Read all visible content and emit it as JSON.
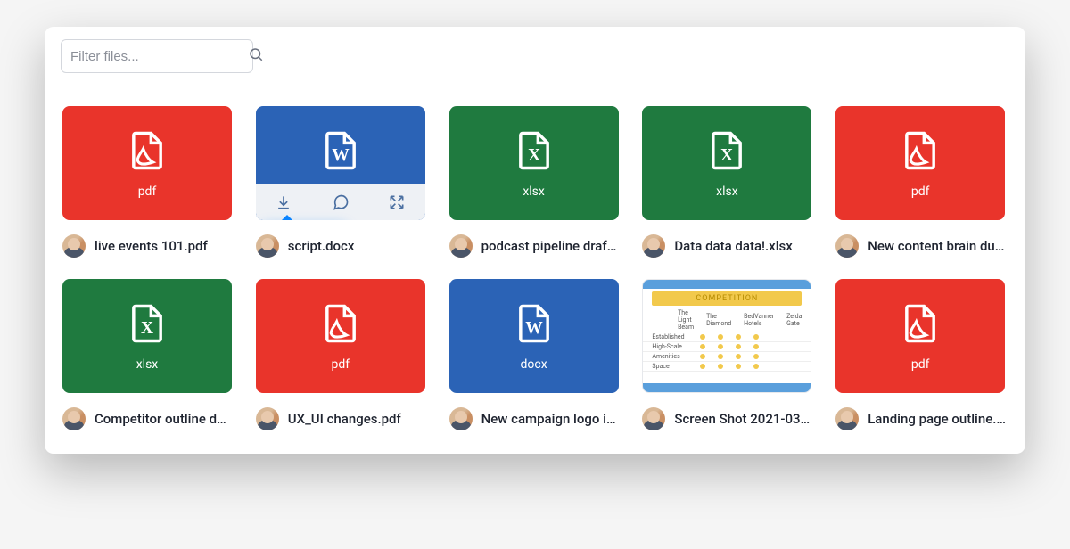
{
  "search": {
    "placeholder": "Filter files..."
  },
  "tooltip": {
    "download": "Download"
  },
  "comp_image": {
    "title": "COMPETITION",
    "rows": [
      "Established",
      "High-Scale",
      "Amenities",
      "Space"
    ],
    "cols": [
      "The Light Beam",
      "The Diamond",
      "BedVanner Hotels",
      "Zelda Gate"
    ]
  },
  "files": [
    {
      "type": "pdf",
      "ext": "pdf",
      "name": "live events 101.pdf"
    },
    {
      "type": "docx",
      "ext": "docx",
      "name": "script.docx",
      "hover": true
    },
    {
      "type": "xlsx",
      "ext": "xlsx",
      "name": "podcast pipeline draft.xlsx"
    },
    {
      "type": "xlsx",
      "ext": "xlsx",
      "name": "Data data data!.xlsx"
    },
    {
      "type": "pdf",
      "ext": "pdf",
      "name": "New content brain dump.pdf"
    },
    {
      "type": "xlsx",
      "ext": "xlsx",
      "name": "Competitor outline doc.xlsx"
    },
    {
      "type": "pdf",
      "ext": "pdf",
      "name": "UX_UI changes.pdf"
    },
    {
      "type": "docx",
      "ext": "docx",
      "name": "New campaign logo ideas.docx"
    },
    {
      "type": "img",
      "ext": "",
      "name": "Screen Shot 2021-03…"
    },
    {
      "type": "pdf",
      "ext": "pdf",
      "name": "Landing page outline.pdf"
    }
  ]
}
